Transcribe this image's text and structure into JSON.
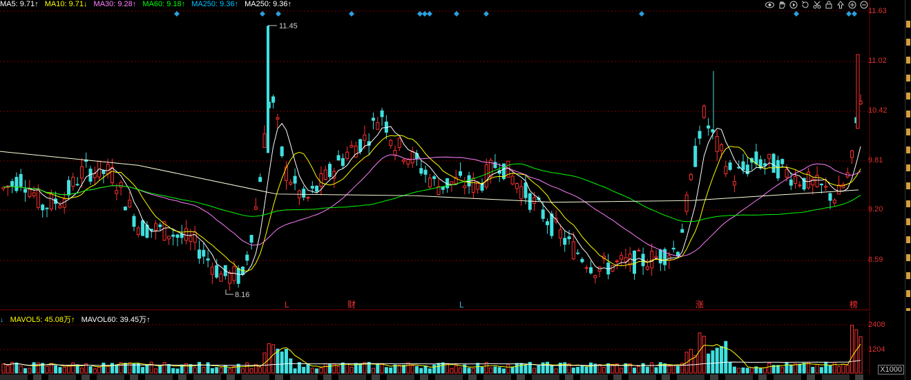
{
  "legend_main": [
    {
      "label": "MA5: 9.71↑",
      "color": "#ffffff"
    },
    {
      "label": "MA10: 9.71↓",
      "color": "#ffff00"
    },
    {
      "label": "MA30: 9.28↑",
      "color": "#ff80ff"
    },
    {
      "label": "MA60: 9.18↑",
      "color": "#00ff00"
    },
    {
      "label": "MA250: 9.36↑",
      "color": "#00c0ff"
    },
    {
      "label": "MA250: 9.36↑",
      "color": "#ffffff"
    }
  ],
  "legend_volume": [
    {
      "label": "MAVOL5: 45.08万↑",
      "color": "#ffff00"
    },
    {
      "label": "MAVOL60: 39.45万↑",
      "color": "#ffffff"
    }
  ],
  "price_axis": [
    "11.63",
    "11.02",
    "10.42",
    "9.81",
    "9.20",
    "8.59"
  ],
  "volume_axis": [
    "2408",
    "1204",
    "X1000"
  ],
  "annotations": {
    "high": "11.45",
    "low": "8.16"
  },
  "event_markers": [
    "L",
    "财",
    "L",
    "涨",
    "榜"
  ],
  "toolbar_icons": [
    "eye-icon",
    "hand-icon",
    "play-icon",
    "refresh-icon",
    "scissors-icon",
    "lock-icon",
    "up-arrow-icon",
    "zoom-in-icon",
    "zoom-out-icon"
  ],
  "colors": {
    "up": "#ff3030",
    "down": "#40e0e0",
    "grid": "#7a0000",
    "marker": "#2aa0e0"
  }
}
